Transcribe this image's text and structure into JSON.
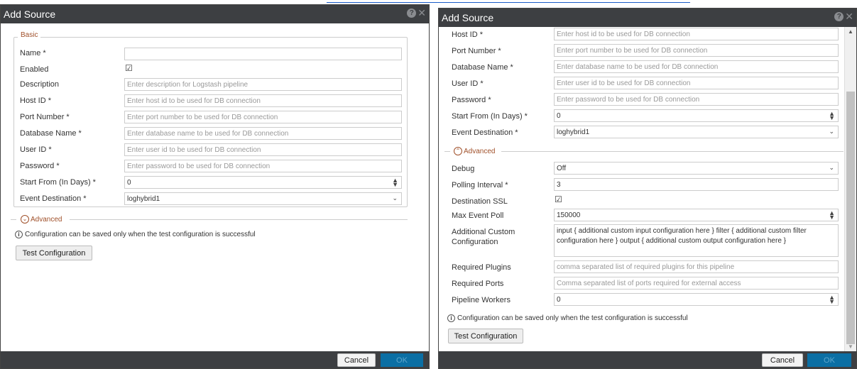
{
  "left_dialog": {
    "title": "Add Source",
    "basic_legend": "Basic",
    "fields": [
      {
        "label": "Name *",
        "value": "",
        "placeholder": ""
      },
      {
        "label": "Enabled",
        "checked": true
      },
      {
        "label": "Description",
        "placeholder": "Enter description for Logstash pipeline"
      },
      {
        "label": "Host ID *",
        "placeholder": "Enter host id to be used for DB connection"
      },
      {
        "label": "Port Number *",
        "placeholder": "Enter port number to be used for DB connection"
      },
      {
        "label": "Database Name *",
        "placeholder": "Enter database name to be used for DB connection"
      },
      {
        "label": "User ID *",
        "placeholder": "Enter user id to be used for DB connection"
      },
      {
        "label": "Password *",
        "placeholder": "Enter password to be used for DB connection"
      },
      {
        "label": "Start From (In Days) *",
        "value": "0"
      },
      {
        "label": "Event Destination *",
        "value": "loghybrid1"
      }
    ],
    "advanced_legend": "Advanced",
    "info_text": "Configuration can be saved only when the test configuration is successful",
    "test_button": "Test Configuration",
    "cancel_button": "Cancel",
    "ok_button": "OK"
  },
  "right_dialog": {
    "title": "Add Source",
    "fields_top": [
      {
        "label": "Host ID *",
        "placeholder": "Enter host id to be used for DB connection"
      },
      {
        "label": "Port Number *",
        "placeholder": "Enter port number to be used for DB connection"
      },
      {
        "label": "Database Name *",
        "placeholder": "Enter database name to be used for DB connection"
      },
      {
        "label": "User ID *",
        "placeholder": "Enter user id to be used for DB connection"
      },
      {
        "label": "Password *",
        "placeholder": "Enter password to be used for DB connection"
      },
      {
        "label": "Start From (In Days) *",
        "value": "0"
      },
      {
        "label": "Event Destination *",
        "value": "loghybrid1"
      }
    ],
    "advanced_legend": "Advanced",
    "fields_adv": [
      {
        "label": "Debug",
        "value": "Off"
      },
      {
        "label": "Polling Interval *",
        "value": "3"
      },
      {
        "label": "Destination SSL",
        "checked": true
      },
      {
        "label": "Max Event Poll",
        "value": "150000"
      },
      {
        "label": "Additional Custom Configuration",
        "value": "input { additional custom input configuration here } filter { additional custom filter configuration here } output { additional custom output configuration here }"
      },
      {
        "label": "Required Plugins",
        "placeholder": "comma separated list of required plugins for this pipeline"
      },
      {
        "label": "Required Ports",
        "placeholder": "Comma separated list of ports required for external access"
      },
      {
        "label": "Pipeline Workers",
        "value": "0"
      }
    ],
    "info_text": "Configuration can be saved only when the test configuration is successful",
    "test_button": "Test Configuration",
    "cancel_button": "Cancel",
    "ok_button": "OK"
  }
}
